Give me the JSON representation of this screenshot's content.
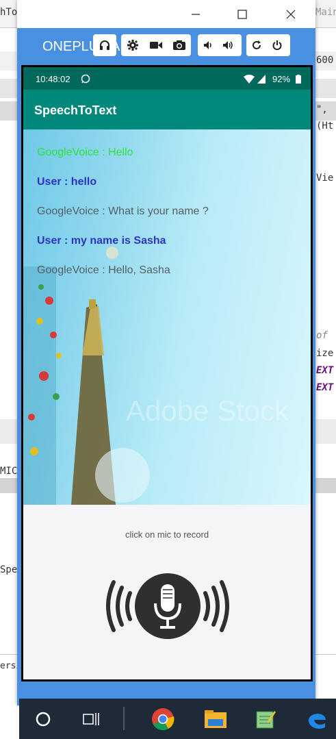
{
  "ide": {
    "left_texts": [
      "hTo",
      "MIC",
      "Spe",
      "ersi"
    ],
    "right_texts": [
      "Main",
      "600",
      "\",",
      "(Ht",
      "Vie",
      "of",
      "ize",
      "EXT",
      "EXT"
    ]
  },
  "window": {
    "device_name": "ONEPLUS A",
    "icons": [
      "minimize-icon",
      "maximize-icon",
      "close-icon"
    ]
  },
  "toolbar": {
    "icons": [
      "headphones-icon",
      "gear-icon",
      "video-icon",
      "camera-icon",
      "volume-down-icon",
      "volume-up-icon",
      "rotate-icon",
      "power-icon"
    ]
  },
  "status": {
    "time": "10:48:02",
    "battery": "92%"
  },
  "app": {
    "title": "SpeechToText"
  },
  "messages": [
    {
      "text": "GoogleVoice : Hello",
      "kind": "g-green"
    },
    {
      "text": "User : hello",
      "kind": "user"
    },
    {
      "text": "GoogleVoice : What is your name ?",
      "kind": "g-gray"
    },
    {
      "text": "User : my name is Sasha",
      "kind": "user"
    },
    {
      "text": "GoogleVoice : Hello, Sasha",
      "kind": "g-gray"
    }
  ],
  "background_watermark": "Adobe Stock",
  "hint": "click on mic to record",
  "colors": {
    "window_blue": "#4a90e2",
    "status_bar": "#00695c",
    "app_bar": "#00897b",
    "google_green": "#2ee23a",
    "user_blue": "#2b33c8",
    "taskbar": "#1f2a38"
  }
}
